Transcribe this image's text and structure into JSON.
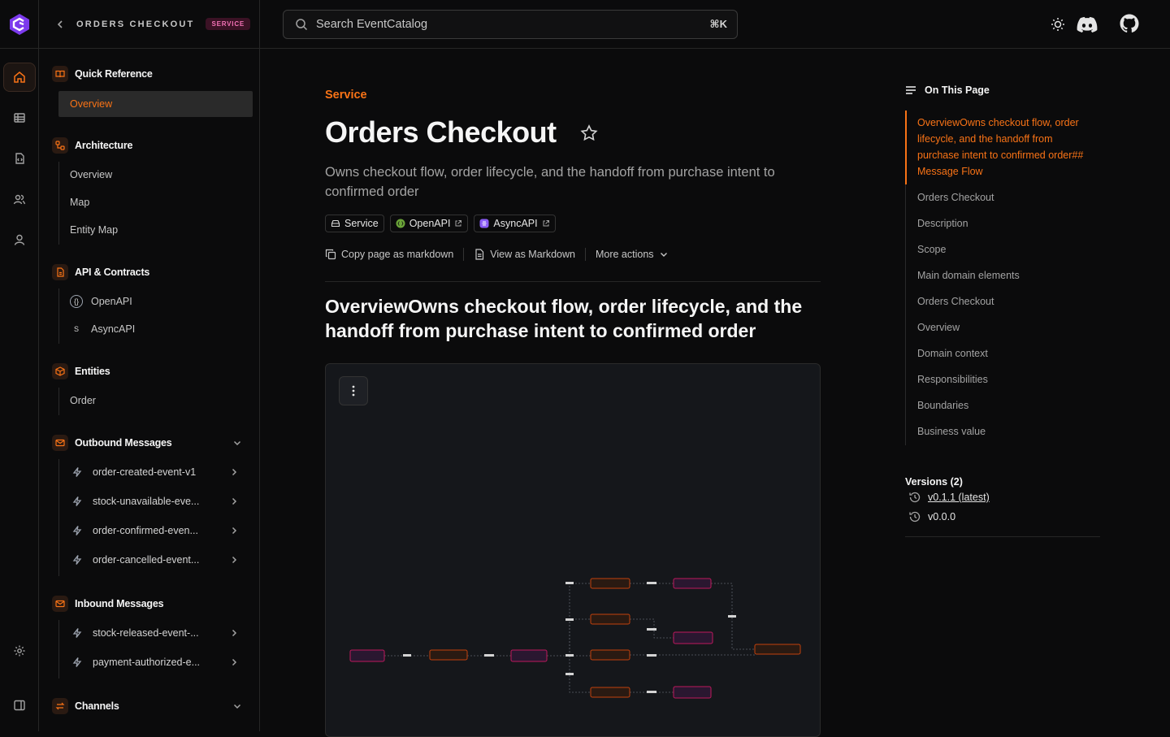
{
  "header": {
    "back_title": "ORDERS CHECKOUT",
    "badge": "SERVICE",
    "search_placeholder": "Search EventCatalog",
    "search_shortcut": "⌘K"
  },
  "rail": {
    "items": [
      "home-icon",
      "table-icon",
      "file-code-icon",
      "users-icon",
      "user-icon",
      "settings-icon",
      "collapse-sidebar-icon"
    ]
  },
  "nav": {
    "quick_reference": {
      "label": "Quick Reference",
      "items": [
        "Overview"
      ]
    },
    "architecture": {
      "label": "Architecture",
      "items": [
        "Overview",
        "Map",
        "Entity Map"
      ]
    },
    "api_contracts": {
      "label": "API & Contracts",
      "items": [
        "OpenAPI",
        "AsyncAPI"
      ]
    },
    "entities": {
      "label": "Entities",
      "items": [
        "Order"
      ]
    },
    "outbound": {
      "label": "Outbound Messages",
      "items": [
        "order-created-event-v1",
        "stock-unavailable-eve...",
        "order-confirmed-even...",
        "order-cancelled-event..."
      ]
    },
    "inbound": {
      "label": "Inbound Messages",
      "items": [
        "stock-released-event-...",
        "payment-authorized-e..."
      ]
    },
    "channels": {
      "label": "Channels"
    }
  },
  "main": {
    "eyebrow": "Service",
    "title": "Orders Checkout",
    "description": "Owns checkout flow, order lifecycle, and the handoff from purchase intent to confirmed order",
    "chips": [
      "Service",
      "OpenAPI",
      "AsyncAPI"
    ],
    "actions": {
      "copy": "Copy page as markdown",
      "view": "View as Markdown",
      "more": "More actions"
    },
    "section_heading": "OverviewOwns checkout flow, order lifecycle, and the handoff from purchase intent to confirmed order"
  },
  "toc": {
    "title": "On This Page",
    "active": "OverviewOwns checkout flow, order lifecycle, and the handoff from purchase intent to confirmed order## Message Flow",
    "items": [
      "Orders Checkout",
      "Description",
      "Scope",
      "Main domain elements",
      "Orders Checkout",
      "Overview",
      "Domain context",
      "Responsibilities",
      "Boundaries",
      "Business value"
    ]
  },
  "versions": {
    "title": "Versions (2)",
    "items": [
      "v0.1.1 (latest)",
      "v0.0.0"
    ]
  },
  "colors": {
    "accent": "#f97316",
    "badge_text": "#f472b6",
    "background": "#0b0b0c"
  }
}
